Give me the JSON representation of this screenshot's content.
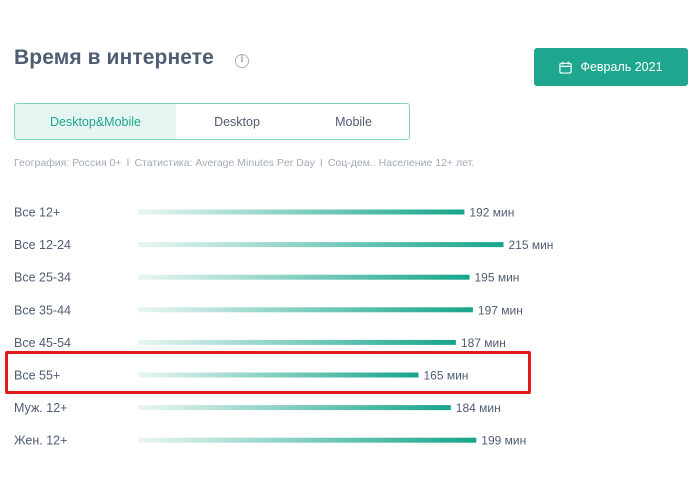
{
  "header": {
    "title": "Время в интернете",
    "info_icon": "info-icon",
    "date_button_label": "Февраль 2021",
    "date_icon": "calendar-icon"
  },
  "tabs": [
    {
      "label": "Desktop&Mobile",
      "active": true
    },
    {
      "label": "Desktop",
      "active": false
    },
    {
      "label": "Mobile",
      "active": false
    }
  ],
  "meta": {
    "geo": "География: Россия 0+",
    "stat": "Статистика: Average Minutes Per Day",
    "demo": "Соц-дем.: Население 12+ лет.",
    "separator": "I"
  },
  "colors": {
    "accent": "#1fa68e",
    "bar_start": "#e9f6f3",
    "bar_end": "#16a58a",
    "highlight": "#e01b1b"
  },
  "chart_data": {
    "type": "bar",
    "orientation": "horizontal",
    "categories": [
      "Все 12+",
      "Все 12-24",
      "Все 25-34",
      "Все 35-44",
      "Все 45-54",
      "Все 55+",
      "Муж. 12+",
      "Жен. 12+"
    ],
    "values": [
      192,
      215,
      195,
      197,
      187,
      165,
      184,
      199
    ],
    "unit": "мин",
    "highlighted_category": "Все 55+",
    "title": "",
    "xlabel": "",
    "ylabel": ""
  }
}
